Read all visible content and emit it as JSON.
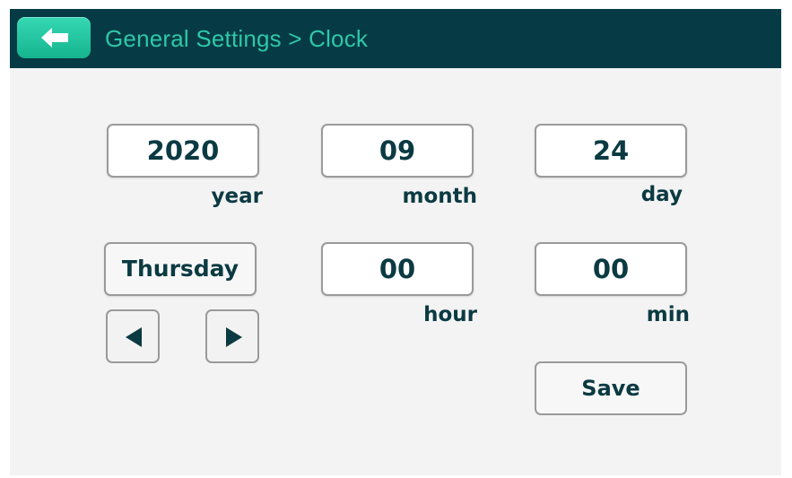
{
  "header": {
    "title": "General Settings > Clock",
    "back_icon": "arrow-left-icon"
  },
  "date": {
    "year": {
      "value": "2020",
      "label": "year"
    },
    "month": {
      "value": "09",
      "label": "month"
    },
    "day": {
      "value": "24",
      "label": "day"
    },
    "weekday": {
      "value": "Thursday"
    }
  },
  "time": {
    "hour": {
      "value": "00",
      "label": "hour"
    },
    "min": {
      "value": "00",
      "label": "min"
    }
  },
  "weekday_nav": {
    "prev_icon": "triangle-left-icon",
    "next_icon": "triangle-right-icon"
  },
  "actions": {
    "save_label": "Save"
  },
  "colors": {
    "header_bg": "#063b45",
    "accent": "#2fc7a8",
    "text": "#0b3a42",
    "background": "#f3f3f3"
  }
}
